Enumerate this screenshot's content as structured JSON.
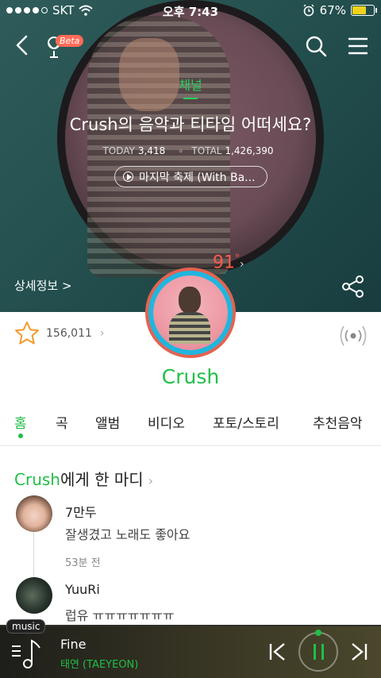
{
  "status_bar": {
    "carrier": "SKT",
    "time": "오후 7:43",
    "battery": "67%",
    "battery_level": 0.67,
    "signal_bars": 4,
    "signal_total": 5
  },
  "header": {
    "beta_badge": "Beta",
    "channel_tag": "채널",
    "title": "Crush의 음악과 티타임 어떠세요?",
    "today_label": "TODAY",
    "today_count": "3,418",
    "total_label": "TOTAL",
    "total_count": "1,426,390",
    "now_playing_chip": "마지막 축제 (With Ba...",
    "temperature": "91",
    "temperature_unit": "°",
    "detail_link": "상세정보 >"
  },
  "artist": {
    "name": "Crush",
    "favorites": "156,011"
  },
  "tabs": [
    {
      "label": "홈",
      "active": true
    },
    {
      "label": "곡",
      "active": false
    },
    {
      "label": "앨범",
      "active": false
    },
    {
      "label": "비디오",
      "active": false
    },
    {
      "label": "포토/스토리",
      "active": false
    },
    {
      "label": "추천음악",
      "active": false
    }
  ],
  "comments_section": {
    "title_artist": "Crush",
    "title_rest": "에게 한 마디",
    "comments": [
      {
        "user": "7만두",
        "text": "잘생겼고 노래도 좋아요",
        "time": "53분 전"
      },
      {
        "user": "YuuRi",
        "text": "럽유 ㅠㅠㅠㅠㅠㅠㅠ",
        "time": ""
      }
    ]
  },
  "player": {
    "tag": "music",
    "track_title": "Fine",
    "track_artist": "태연 (TAEYEON)"
  },
  "colors": {
    "accent_green": "#1fbf46",
    "temperature_red": "#ff5a4a",
    "beta_orange": "#ff6b57",
    "battery_yellow": "#f3d21b"
  },
  "icons": {
    "back": "chevron-left-icon",
    "mic_beta": "microphone-icon",
    "search": "search-icon",
    "menu": "hamburger-menu-icon",
    "share": "share-icon",
    "favorite": "star-icon",
    "broadcast": "broadcast-icon",
    "playlist": "music-note-playlist-icon",
    "prev": "skip-previous-icon",
    "pause": "pause-icon",
    "next": "skip-next-icon"
  }
}
